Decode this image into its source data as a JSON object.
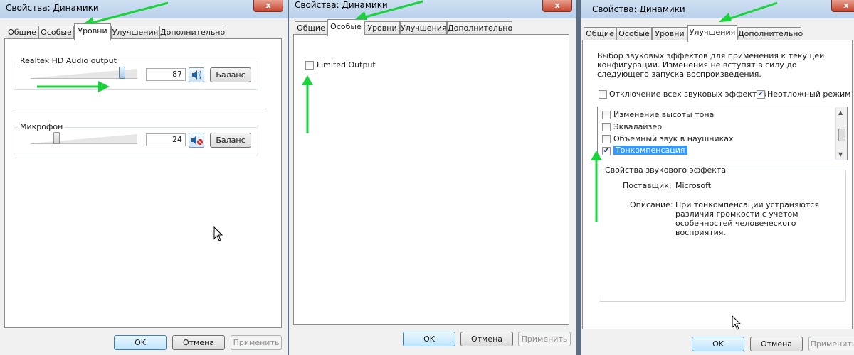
{
  "title": "Свойства: Динамики",
  "close_glyph": "x",
  "tabs": {
    "general": "Общие",
    "special": "Особые",
    "levels": "Уровни",
    "enhancements": "Улучшения",
    "advanced": "Дополнительно"
  },
  "buttons": {
    "ok": "OK",
    "cancel": "Отмена",
    "apply": "Применить"
  },
  "levels": {
    "output": {
      "label": "Realtek HD Audio output",
      "value": "87",
      "balance": "Баланс",
      "mute_icon": "speaker-icon"
    },
    "mic": {
      "label": "Микрофон",
      "value": "24",
      "balance": "Баланс",
      "mute_icon": "speaker-muted-icon"
    }
  },
  "special": {
    "limited_output": "Limited Output",
    "limited_checked": false
  },
  "enhancements": {
    "description": "Выбор звуковых эффектов для применения к текущей конфигурации. Изменения не вступят в силу до следующего запуска воспроизведения.",
    "disable_all": "Отключение всех звуковых эффектов",
    "immediate_mode": "Неотложный режим",
    "effects": [
      {
        "label": "Изменение высоты тона",
        "checked": false
      },
      {
        "label": "Эквалайзер",
        "checked": false
      },
      {
        "label": "Объемный звук в наушниках",
        "checked": false
      },
      {
        "label": "Тонкомпенсация",
        "checked": true
      }
    ],
    "properties_title": "Свойства звукового эффекта",
    "provider_label": "Поставщик:",
    "provider_value": "Microsoft",
    "description_label": "Описание:",
    "description_value": "При тонкомпенсации устраняются различия громкости с учетом особенностей человеческого восприятия."
  },
  "colors": {
    "arrow": "#1bd23c",
    "selection": "#3399ff",
    "title_bar": "#c4d8ef"
  }
}
